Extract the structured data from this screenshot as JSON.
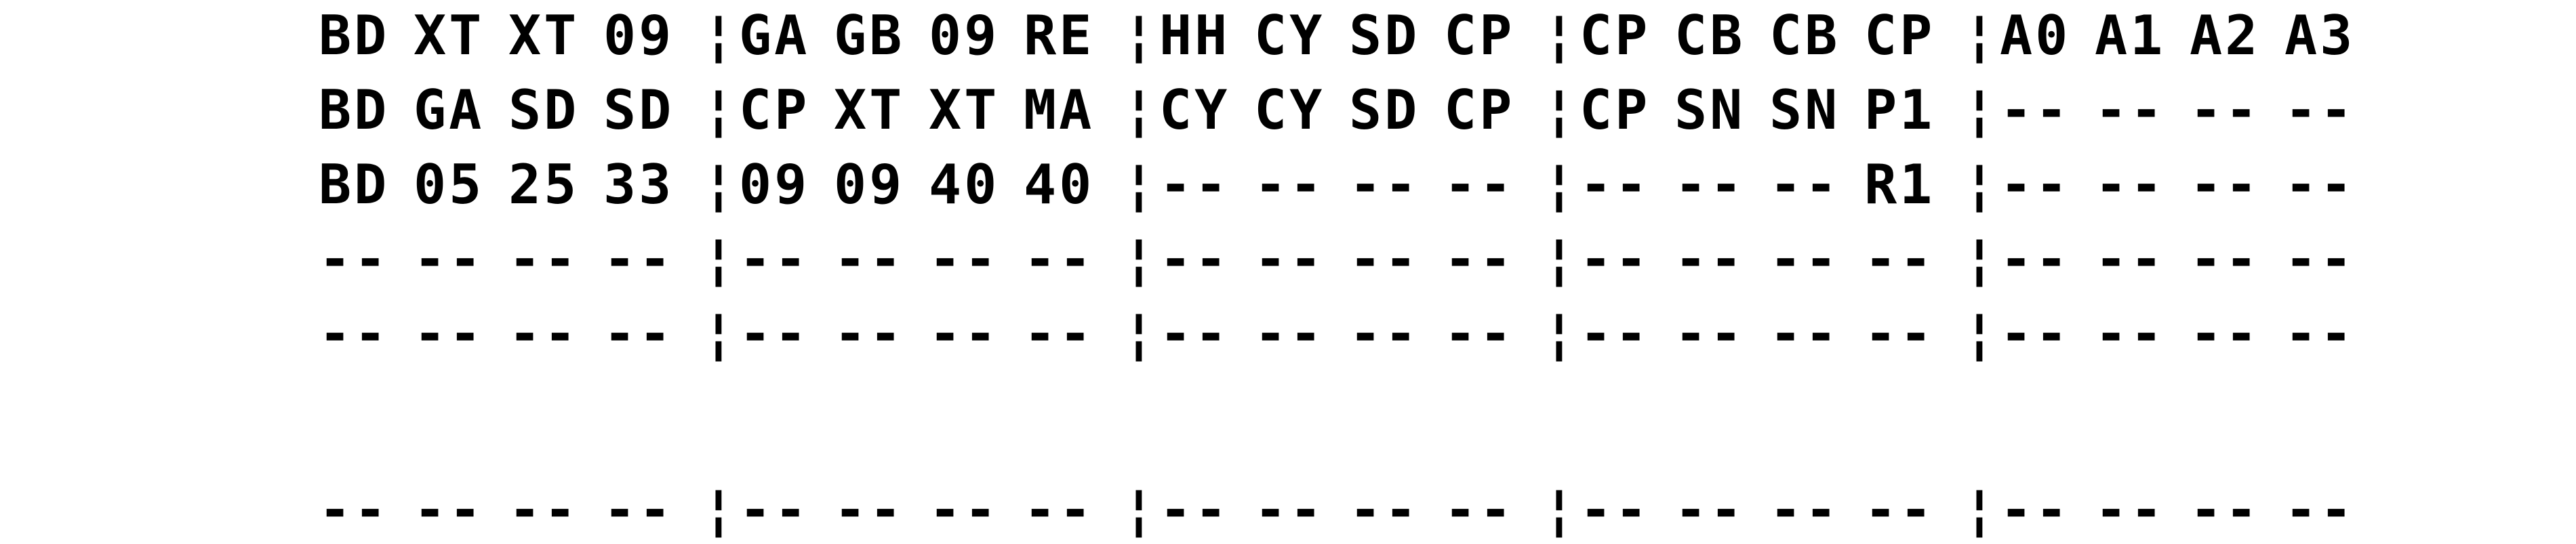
{
  "separator": "¦",
  "rows": [
    {
      "groups": [
        [
          "BD",
          "XT",
          "XT",
          "09"
        ],
        [
          "GA",
          "GB",
          "09",
          "RE"
        ],
        [
          "HH",
          "CY",
          "SD",
          "CP"
        ],
        [
          "CP",
          "CB",
          "CB",
          "CP"
        ],
        [
          "A0",
          "A1",
          "A2",
          "A3"
        ]
      ]
    },
    {
      "groups": [
        [
          "BD",
          "GA",
          "SD",
          "SD"
        ],
        [
          "CP",
          "XT",
          "XT",
          "MA"
        ],
        [
          "CY",
          "CY",
          "SD",
          "CP"
        ],
        [
          "CP",
          "SN",
          "SN",
          "P1"
        ],
        [
          "--",
          "--",
          "--",
          "--"
        ]
      ]
    },
    {
      "groups": [
        [
          "BD",
          "05",
          "25",
          "33"
        ],
        [
          "09",
          "09",
          "40",
          "40"
        ],
        [
          "--",
          "--",
          "--",
          "--"
        ],
        [
          "--",
          "--",
          "--",
          "R1"
        ],
        [
          "--",
          "--",
          "--",
          "--"
        ]
      ]
    },
    {
      "groups": [
        [
          "--",
          "--",
          "--",
          "--"
        ],
        [
          "--",
          "--",
          "--",
          "--"
        ],
        [
          "--",
          "--",
          "--",
          "--"
        ],
        [
          "--",
          "--",
          "--",
          "--"
        ],
        [
          "--",
          "--",
          "--",
          "--"
        ]
      ]
    },
    {
      "groups": [
        [
          "--",
          "--",
          "--",
          "--"
        ],
        [
          "--",
          "--",
          "--",
          "--"
        ],
        [
          "--",
          "--",
          "--",
          "--"
        ],
        [
          "--",
          "--",
          "--",
          "--"
        ],
        [
          "--",
          "--",
          "--",
          "--"
        ]
      ]
    },
    {
      "groups": [
        [
          "--",
          "--",
          "--",
          "--"
        ],
        [
          "--",
          "--",
          "--",
          "--"
        ],
        [
          "--",
          "--",
          "--",
          "--"
        ],
        [
          "--",
          "--",
          "--",
          "--"
        ],
        [
          "--",
          "--",
          "--",
          "--"
        ]
      ]
    }
  ]
}
